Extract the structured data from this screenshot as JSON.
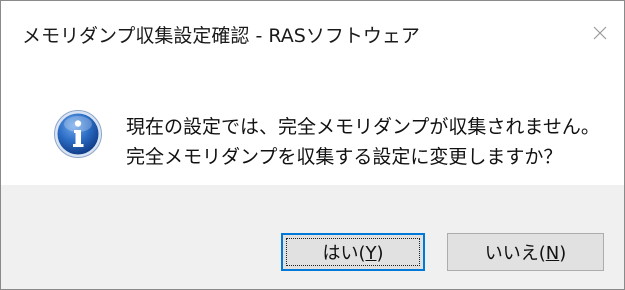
{
  "window": {
    "title": "メモリダンプ収集設定確認 - RASソフトウェア",
    "close_icon": "close-icon"
  },
  "message": {
    "icon": "info-icon",
    "icon_color": "#1f5fb5",
    "line1": "現在の設定では、完全メモリダンプが収集されません。",
    "line2": "完全メモリダンプを収集する設定に変更しますか？"
  },
  "buttons": {
    "yes": {
      "prefix": "はい(",
      "mnemonic": "Y",
      "suffix": ")",
      "is_default": true,
      "accent_color": "#0078d7"
    },
    "no": {
      "prefix": "いいえ(",
      "mnemonic": "N",
      "suffix": ")"
    }
  }
}
